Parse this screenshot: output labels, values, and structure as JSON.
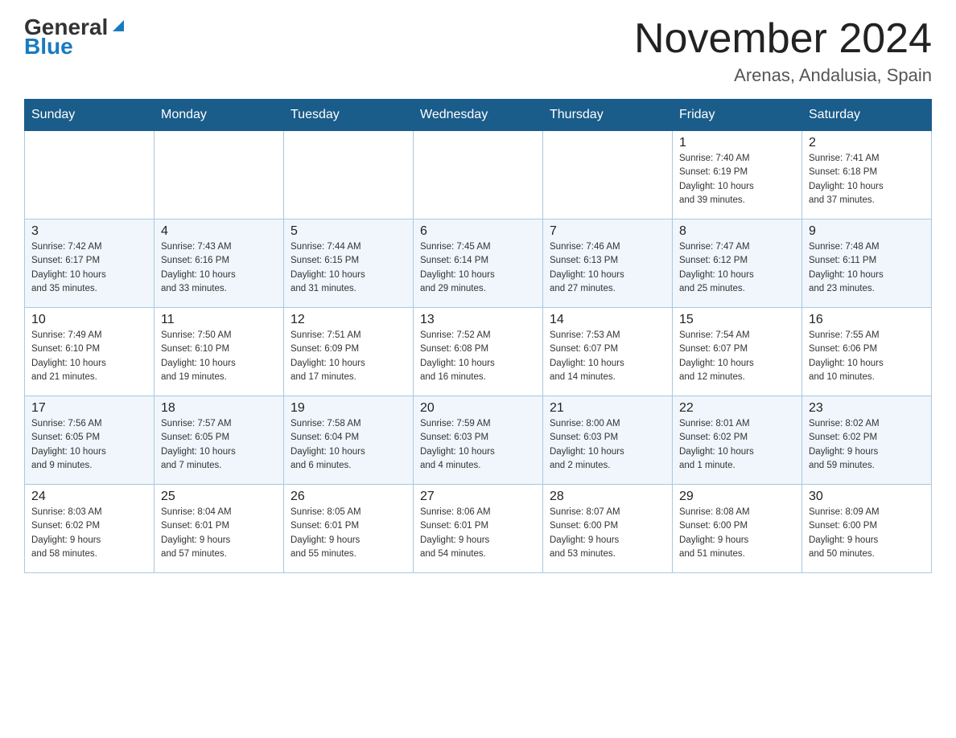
{
  "header": {
    "logo_general": "General",
    "logo_blue": "Blue",
    "month_title": "November 2024",
    "location": "Arenas, Andalusia, Spain"
  },
  "days_of_week": [
    "Sunday",
    "Monday",
    "Tuesday",
    "Wednesday",
    "Thursday",
    "Friday",
    "Saturday"
  ],
  "weeks": [
    {
      "days": [
        {
          "number": "",
          "info": ""
        },
        {
          "number": "",
          "info": ""
        },
        {
          "number": "",
          "info": ""
        },
        {
          "number": "",
          "info": ""
        },
        {
          "number": "",
          "info": ""
        },
        {
          "number": "1",
          "info": "Sunrise: 7:40 AM\nSunset: 6:19 PM\nDaylight: 10 hours\nand 39 minutes."
        },
        {
          "number": "2",
          "info": "Sunrise: 7:41 AM\nSunset: 6:18 PM\nDaylight: 10 hours\nand 37 minutes."
        }
      ]
    },
    {
      "days": [
        {
          "number": "3",
          "info": "Sunrise: 7:42 AM\nSunset: 6:17 PM\nDaylight: 10 hours\nand 35 minutes."
        },
        {
          "number": "4",
          "info": "Sunrise: 7:43 AM\nSunset: 6:16 PM\nDaylight: 10 hours\nand 33 minutes."
        },
        {
          "number": "5",
          "info": "Sunrise: 7:44 AM\nSunset: 6:15 PM\nDaylight: 10 hours\nand 31 minutes."
        },
        {
          "number": "6",
          "info": "Sunrise: 7:45 AM\nSunset: 6:14 PM\nDaylight: 10 hours\nand 29 minutes."
        },
        {
          "number": "7",
          "info": "Sunrise: 7:46 AM\nSunset: 6:13 PM\nDaylight: 10 hours\nand 27 minutes."
        },
        {
          "number": "8",
          "info": "Sunrise: 7:47 AM\nSunset: 6:12 PM\nDaylight: 10 hours\nand 25 minutes."
        },
        {
          "number": "9",
          "info": "Sunrise: 7:48 AM\nSunset: 6:11 PM\nDaylight: 10 hours\nand 23 minutes."
        }
      ]
    },
    {
      "days": [
        {
          "number": "10",
          "info": "Sunrise: 7:49 AM\nSunset: 6:10 PM\nDaylight: 10 hours\nand 21 minutes."
        },
        {
          "number": "11",
          "info": "Sunrise: 7:50 AM\nSunset: 6:10 PM\nDaylight: 10 hours\nand 19 minutes."
        },
        {
          "number": "12",
          "info": "Sunrise: 7:51 AM\nSunset: 6:09 PM\nDaylight: 10 hours\nand 17 minutes."
        },
        {
          "number": "13",
          "info": "Sunrise: 7:52 AM\nSunset: 6:08 PM\nDaylight: 10 hours\nand 16 minutes."
        },
        {
          "number": "14",
          "info": "Sunrise: 7:53 AM\nSunset: 6:07 PM\nDaylight: 10 hours\nand 14 minutes."
        },
        {
          "number": "15",
          "info": "Sunrise: 7:54 AM\nSunset: 6:07 PM\nDaylight: 10 hours\nand 12 minutes."
        },
        {
          "number": "16",
          "info": "Sunrise: 7:55 AM\nSunset: 6:06 PM\nDaylight: 10 hours\nand 10 minutes."
        }
      ]
    },
    {
      "days": [
        {
          "number": "17",
          "info": "Sunrise: 7:56 AM\nSunset: 6:05 PM\nDaylight: 10 hours\nand 9 minutes."
        },
        {
          "number": "18",
          "info": "Sunrise: 7:57 AM\nSunset: 6:05 PM\nDaylight: 10 hours\nand 7 minutes."
        },
        {
          "number": "19",
          "info": "Sunrise: 7:58 AM\nSunset: 6:04 PM\nDaylight: 10 hours\nand 6 minutes."
        },
        {
          "number": "20",
          "info": "Sunrise: 7:59 AM\nSunset: 6:03 PM\nDaylight: 10 hours\nand 4 minutes."
        },
        {
          "number": "21",
          "info": "Sunrise: 8:00 AM\nSunset: 6:03 PM\nDaylight: 10 hours\nand 2 minutes."
        },
        {
          "number": "22",
          "info": "Sunrise: 8:01 AM\nSunset: 6:02 PM\nDaylight: 10 hours\nand 1 minute."
        },
        {
          "number": "23",
          "info": "Sunrise: 8:02 AM\nSunset: 6:02 PM\nDaylight: 9 hours\nand 59 minutes."
        }
      ]
    },
    {
      "days": [
        {
          "number": "24",
          "info": "Sunrise: 8:03 AM\nSunset: 6:02 PM\nDaylight: 9 hours\nand 58 minutes."
        },
        {
          "number": "25",
          "info": "Sunrise: 8:04 AM\nSunset: 6:01 PM\nDaylight: 9 hours\nand 57 minutes."
        },
        {
          "number": "26",
          "info": "Sunrise: 8:05 AM\nSunset: 6:01 PM\nDaylight: 9 hours\nand 55 minutes."
        },
        {
          "number": "27",
          "info": "Sunrise: 8:06 AM\nSunset: 6:01 PM\nDaylight: 9 hours\nand 54 minutes."
        },
        {
          "number": "28",
          "info": "Sunrise: 8:07 AM\nSunset: 6:00 PM\nDaylight: 9 hours\nand 53 minutes."
        },
        {
          "number": "29",
          "info": "Sunrise: 8:08 AM\nSunset: 6:00 PM\nDaylight: 9 hours\nand 51 minutes."
        },
        {
          "number": "30",
          "info": "Sunrise: 8:09 AM\nSunset: 6:00 PM\nDaylight: 9 hours\nand 50 minutes."
        }
      ]
    }
  ]
}
